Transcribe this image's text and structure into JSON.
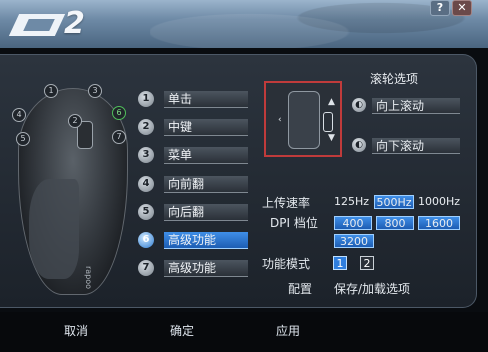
{
  "window": {
    "logo_text": "2",
    "help_label": "?",
    "close_label": "✕",
    "colors": {
      "header": "#6e8aa6",
      "accent": "#2d7ad0",
      "selection_frame": "#c03b3b"
    }
  },
  "mouse": {
    "callouts": [
      "1",
      "2",
      "3",
      "4",
      "5",
      "6",
      "7"
    ],
    "brand_text": "rapoo"
  },
  "buttons": [
    {
      "num": "1",
      "label": "单击"
    },
    {
      "num": "2",
      "label": "中键"
    },
    {
      "num": "3",
      "label": "菜单"
    },
    {
      "num": "4",
      "label": "向前翻"
    },
    {
      "num": "5",
      "label": "向后翻"
    },
    {
      "num": "6",
      "label": "高级功能",
      "selected": true
    },
    {
      "num": "7",
      "label": "高级功能"
    }
  ],
  "scroll": {
    "title": "滚轮选项",
    "up_label": "向上滚动",
    "down_label": "向下滚动",
    "up_icon": "arrow-up-icon",
    "down_icon": "arrow-down-icon"
  },
  "settings": {
    "report_rate_label": "上传速率",
    "report_rates": [
      "125Hz",
      "500Hz",
      "1000Hz"
    ],
    "report_rate_selected": "500Hz",
    "dpi_label": "DPI 档位",
    "dpi_options": [
      "400",
      "800",
      "1600",
      "3200"
    ],
    "mode_label": "功能模式",
    "modes": [
      "1",
      "2"
    ],
    "mode_selected": "1",
    "config_label": "配置",
    "config_value": "保存/加载选项"
  },
  "footer": {
    "cancel": "取消",
    "ok": "确定",
    "apply": "应用"
  }
}
